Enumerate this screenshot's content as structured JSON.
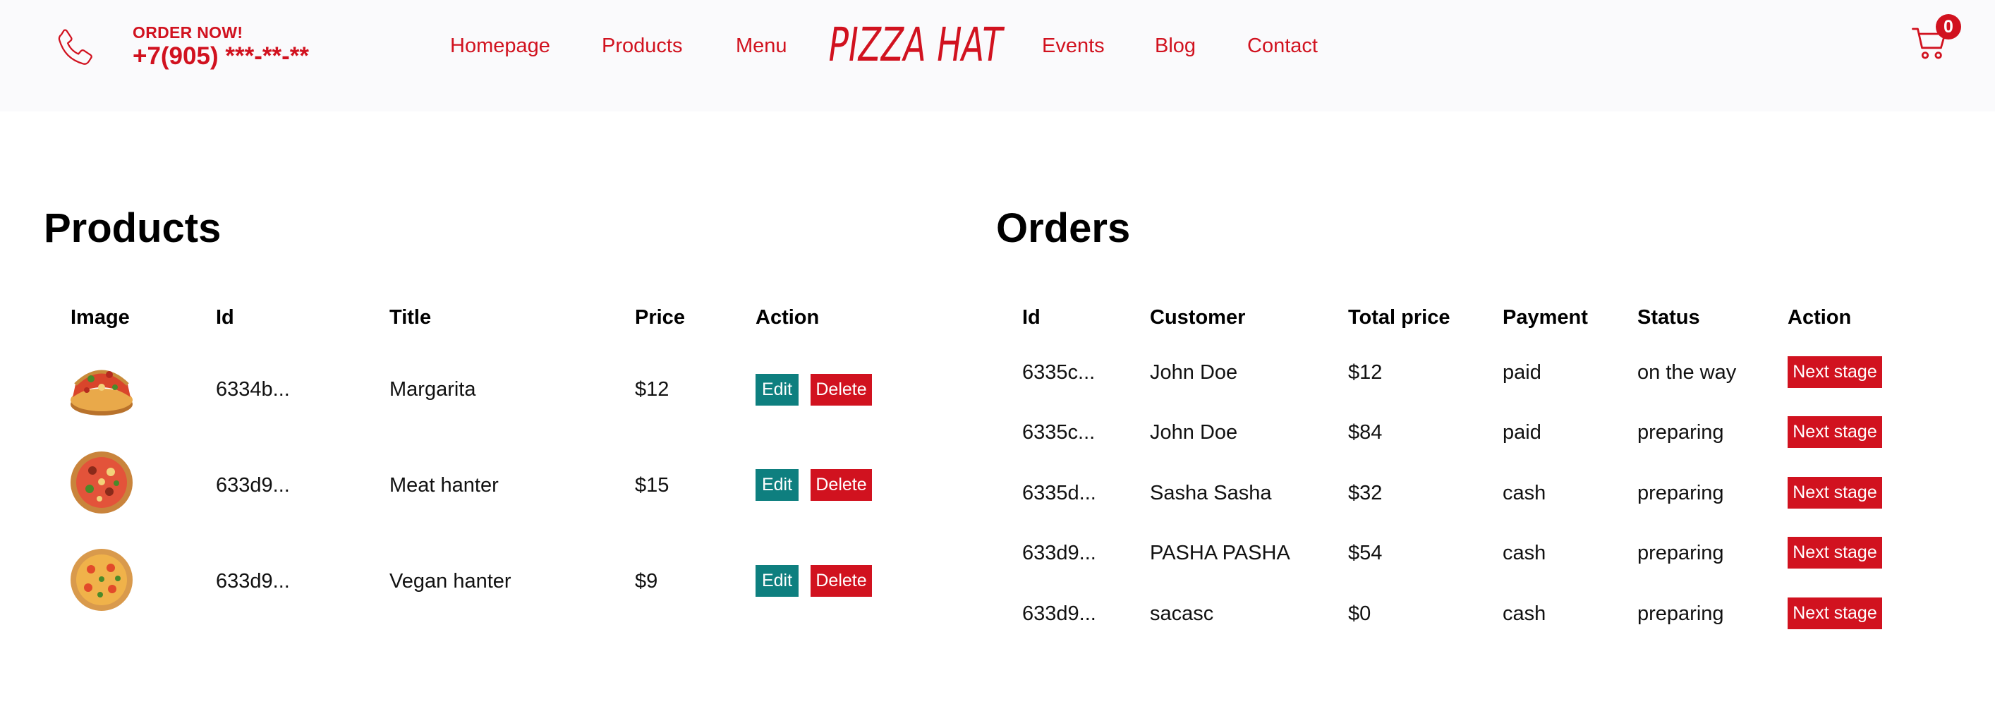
{
  "header": {
    "order_now": "ORDER NOW!",
    "phone": "+7(905) ***-**-**",
    "nav": [
      "Homepage",
      "Products",
      "Menu",
      "Events",
      "Blog",
      "Contact"
    ],
    "logo": "PIZZA HAT",
    "cart_count": "0"
  },
  "colors": {
    "accent": "#d1121f",
    "edit": "#0e7f7f",
    "header_bg": "#fafafc"
  },
  "products": {
    "title": "Products",
    "columns": [
      "Image",
      "Id",
      "Title",
      "Price",
      "Action"
    ],
    "rows": [
      {
        "image": "pizza-slice-image",
        "id": "6334b...",
        "title": "Margarita",
        "price": "$12",
        "edit": "Edit",
        "delete": "Delete"
      },
      {
        "image": "pizza-image",
        "id": "633d9...",
        "title": "Meat hanter",
        "price": "$15",
        "edit": "Edit",
        "delete": "Delete"
      },
      {
        "image": "pizza-image",
        "id": "633d9...",
        "title": "Vegan hanter",
        "price": "$9",
        "edit": "Edit",
        "delete": "Delete"
      }
    ]
  },
  "orders": {
    "title": "Orders",
    "columns": [
      "Id",
      "Customer",
      "Total price",
      "Payment",
      "Status",
      "Action"
    ],
    "rows": [
      {
        "id": "6335c...",
        "customer": "John Doe",
        "total": "$12",
        "payment": "paid",
        "status": "on the way",
        "action": "Next stage"
      },
      {
        "id": "6335c...",
        "customer": "John Doe",
        "total": "$84",
        "payment": "paid",
        "status": "preparing",
        "action": "Next stage"
      },
      {
        "id": "6335d...",
        "customer": "Sasha Sasha",
        "total": "$32",
        "payment": "cash",
        "status": "preparing",
        "action": "Next stage"
      },
      {
        "id": "633d9...",
        "customer": "PASHA PASHA",
        "total": "$54",
        "payment": "cash",
        "status": "preparing",
        "action": "Next stage"
      },
      {
        "id": "633d9...",
        "customer": "sacasc",
        "total": "$0",
        "payment": "cash",
        "status": "preparing",
        "action": "Next stage"
      }
    ]
  }
}
